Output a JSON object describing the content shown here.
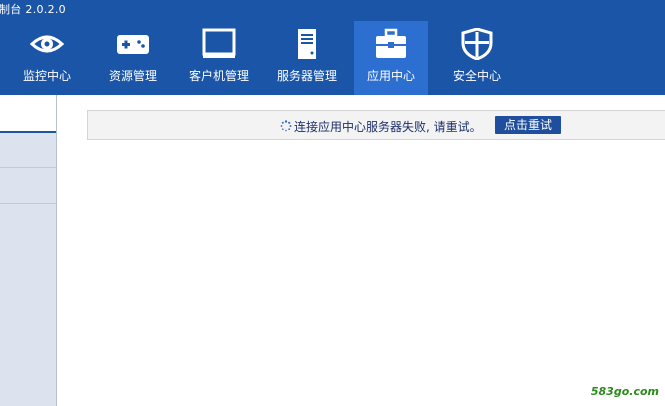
{
  "window": {
    "title": "制台 2.0.2.0"
  },
  "nav": {
    "items": [
      {
        "label": "监控中心",
        "icon": "eye-icon"
      },
      {
        "label": "资源管理",
        "icon": "gamepad-icon"
      },
      {
        "label": "客户机管理",
        "icon": "monitor-icon"
      },
      {
        "label": "服务器管理",
        "icon": "server-icon"
      },
      {
        "label": "应用中心",
        "icon": "toolbox-icon",
        "active": true
      },
      {
        "label": "安全中心",
        "icon": "shield-icon"
      }
    ]
  },
  "notice": {
    "message": "连接应用中心服务器失败, 请重试。",
    "retry_label": "点击重试"
  },
  "watermark": "583go.com",
  "colors": {
    "header_bg": "#1b55a8",
    "active_tab": "#2c6fd1",
    "button_bg": "#1f4f9c",
    "sidebar_bg": "#dde3ee"
  }
}
